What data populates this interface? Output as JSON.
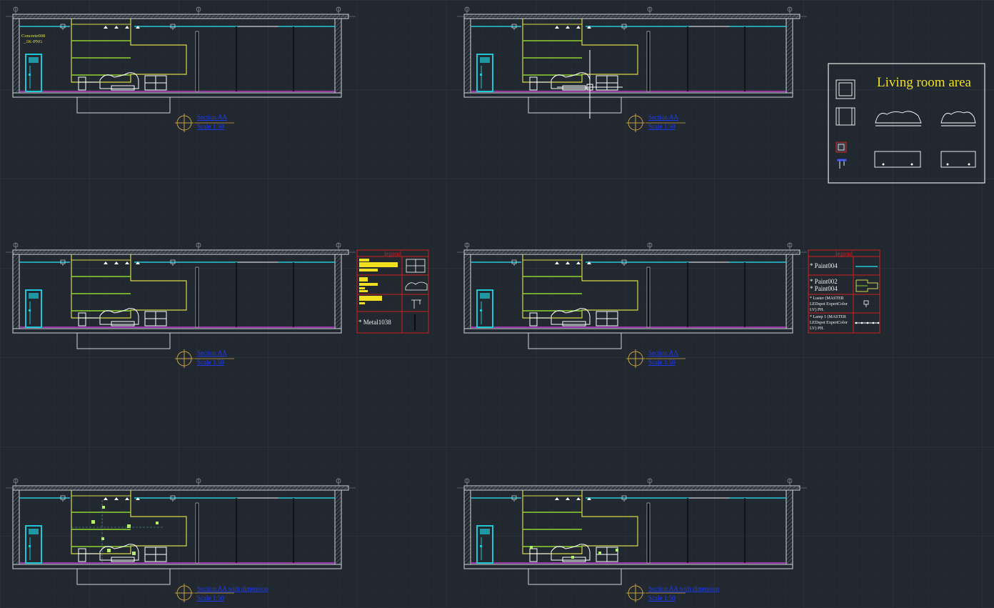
{
  "panel": {
    "title": "Living room area"
  },
  "sections": [
    {
      "title": "Section AA",
      "scale": "Scale 1:50",
      "note_line1": "Concrete008",
      "note_line2": "_1K-PNG"
    },
    {
      "title": "Section AA",
      "scale": "Scale 1:50"
    },
    {
      "title": "Section AA",
      "scale": "Scale 1:50"
    },
    {
      "title": "Section AA",
      "scale": "Scale 1:50"
    },
    {
      "title": "Section AA   with dimension",
      "scale": "Scale 1:50"
    },
    {
      "title": "Section AA   with dimension",
      "scale": "Scale 1:50"
    }
  ],
  "legend1": {
    "title": "legend",
    "material": "Metal1038"
  },
  "legend2": {
    "title": "legend",
    "row1": "Paint004",
    "row2a": "Paint002",
    "row2b": "Paint004",
    "row3a": "Luster (MASTER",
    "row3b": "LEDspot ExpertColor",
    "row3c": "LV) PH.",
    "row4a": "Lamp 1 (MASTER",
    "row4b": "LEDspot ExpertColor",
    "row4c": "LV) PH."
  },
  "colors": {
    "background": "#212830",
    "grid": "#2b333c",
    "wall": "#cfd6dc",
    "ceiling": "#27c9d8",
    "panel_yellow": "#d8d84a",
    "shelf_green": "#8fd12e",
    "floor_magenta": "#c040d0",
    "legend_red": "#d21e1e",
    "label_blue": "#1e3cff",
    "door_cyan": "#1fc7d6"
  }
}
